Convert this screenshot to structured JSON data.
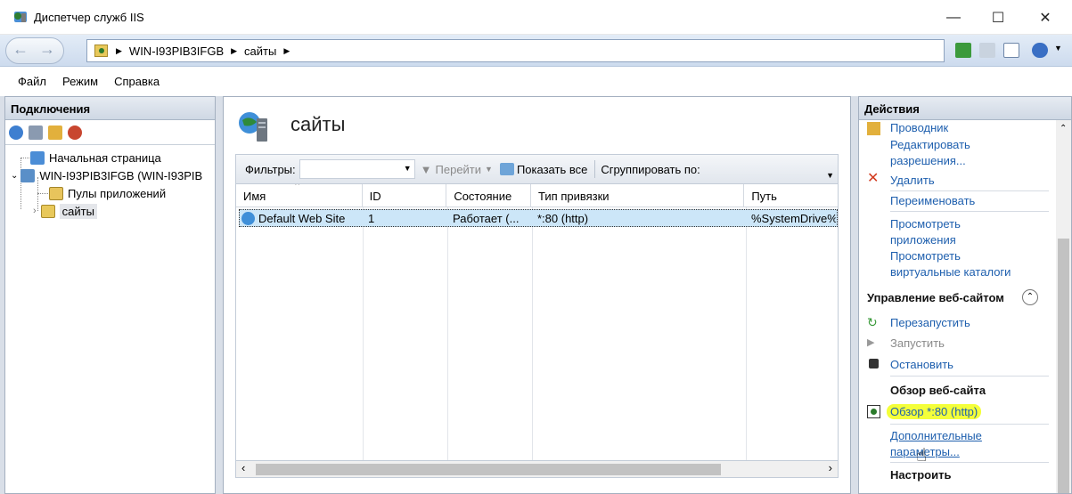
{
  "window": {
    "title": "Диспетчер служб IIS",
    "minimize_glyph": "—",
    "maximize_glyph": "☐",
    "close_glyph": "✕"
  },
  "address": {
    "crumbs": [
      "WIN-I93PIB3IFGB",
      "сайты"
    ],
    "separator_glyph": "▶"
  },
  "menu": [
    "Файл",
    "Режим",
    "Справка"
  ],
  "connections": {
    "header": "Подключения",
    "tree": {
      "start_page": "Начальная страница",
      "server": "WIN-I93PIB3IFGB (WIN-I93PIB",
      "app_pools": "Пулы приложений",
      "sites": "сайты"
    }
  },
  "center": {
    "title": "сайты",
    "filter": {
      "label": "Фильтры:",
      "go_label": "Перейти",
      "show_all_label": "Показать все",
      "group_label": "Сгруппировать по:"
    },
    "columns": [
      "Имя",
      "ID",
      "Состояние",
      "Тип привязки",
      "Путь"
    ],
    "rows": [
      {
        "name": "Default Web Site",
        "id": "1",
        "state": "Работает (...",
        "binding": "*:80 (http)",
        "path": "%SystemDrive%"
      }
    ]
  },
  "actions": {
    "header": "Действия",
    "explore": "Проводник",
    "edit_permissions_1": "Редактировать",
    "edit_permissions_2": "разрешения...",
    "delete": "Удалить",
    "rename": "Переименовать",
    "view_apps_1": "Просмотреть",
    "view_apps_2": "приложения",
    "view_vdirs_1": "Просмотреть",
    "view_vdirs_2": "виртуальные каталоги",
    "manage_site_heading": "Управление веб-сайтом",
    "restart": "Перезапустить",
    "start": "Запустить",
    "stop": "Остановить",
    "browse_heading": "Обзор веб-сайта",
    "browse_http": "Обзор *:80 (http)",
    "advanced_1": "Дополнительные",
    "advanced_2": "параметры...",
    "configure_heading": "Настроить",
    "highlight_color": "#f4ff3a"
  }
}
